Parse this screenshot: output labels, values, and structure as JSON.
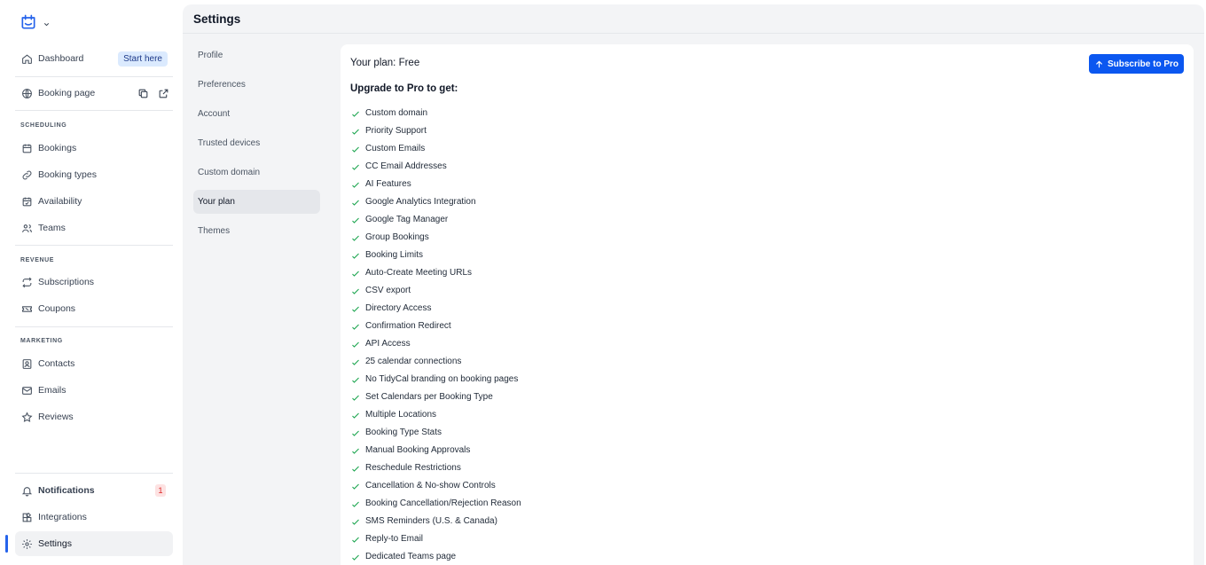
{
  "sidebar": {
    "dashboard": "Dashboard",
    "start_here": "Start here",
    "booking_page": "Booking page",
    "sections": {
      "scheduling": "SCHEDULING",
      "revenue": "REVENUE",
      "marketing": "MARKETING"
    },
    "bookings": "Bookings",
    "booking_types": "Booking types",
    "availability": "Availability",
    "teams": "Teams",
    "subscriptions": "Subscriptions",
    "coupons": "Coupons",
    "contacts": "Contacts",
    "emails": "Emails",
    "reviews": "Reviews",
    "notifications": "Notifications",
    "notifications_count": "1",
    "integrations": "Integrations",
    "settings": "Settings"
  },
  "header": {
    "title": "Settings"
  },
  "settings_nav": {
    "items": [
      "Profile",
      "Preferences",
      "Account",
      "Trusted devices",
      "Custom domain",
      "Your plan",
      "Themes"
    ],
    "active": "Your plan"
  },
  "plan": {
    "title": "Your plan: Free",
    "subscribe_label": "Subscribe to Pro",
    "upgrade_title": "Upgrade to Pro to get:",
    "features": [
      "Custom domain",
      "Priority Support",
      "Custom Emails",
      "CC Email Addresses",
      "AI Features",
      "Google Analytics Integration",
      "Google Tag Manager",
      "Group Bookings",
      "Booking Limits",
      "Auto-Create Meeting URLs",
      "CSV export",
      "Directory Access",
      "Confirmation Redirect",
      "API Access",
      "25 calendar connections",
      "No TidyCal branding on booking pages",
      "Set Calendars per Booking Type",
      "Multiple Locations",
      "Booking Type Stats",
      "Manual Booking Approvals",
      "Reschedule Restrictions",
      "Cancellation & No-show Controls",
      "Booking Cancellation/Rejection Reason",
      "SMS Reminders (U.S. & Canada)",
      "Reply-to Email",
      "Dedicated Teams page"
    ]
  },
  "colors": {
    "accent": "#0b57f0",
    "check": "#16a34a",
    "badge_bg": "#dbeafe"
  }
}
